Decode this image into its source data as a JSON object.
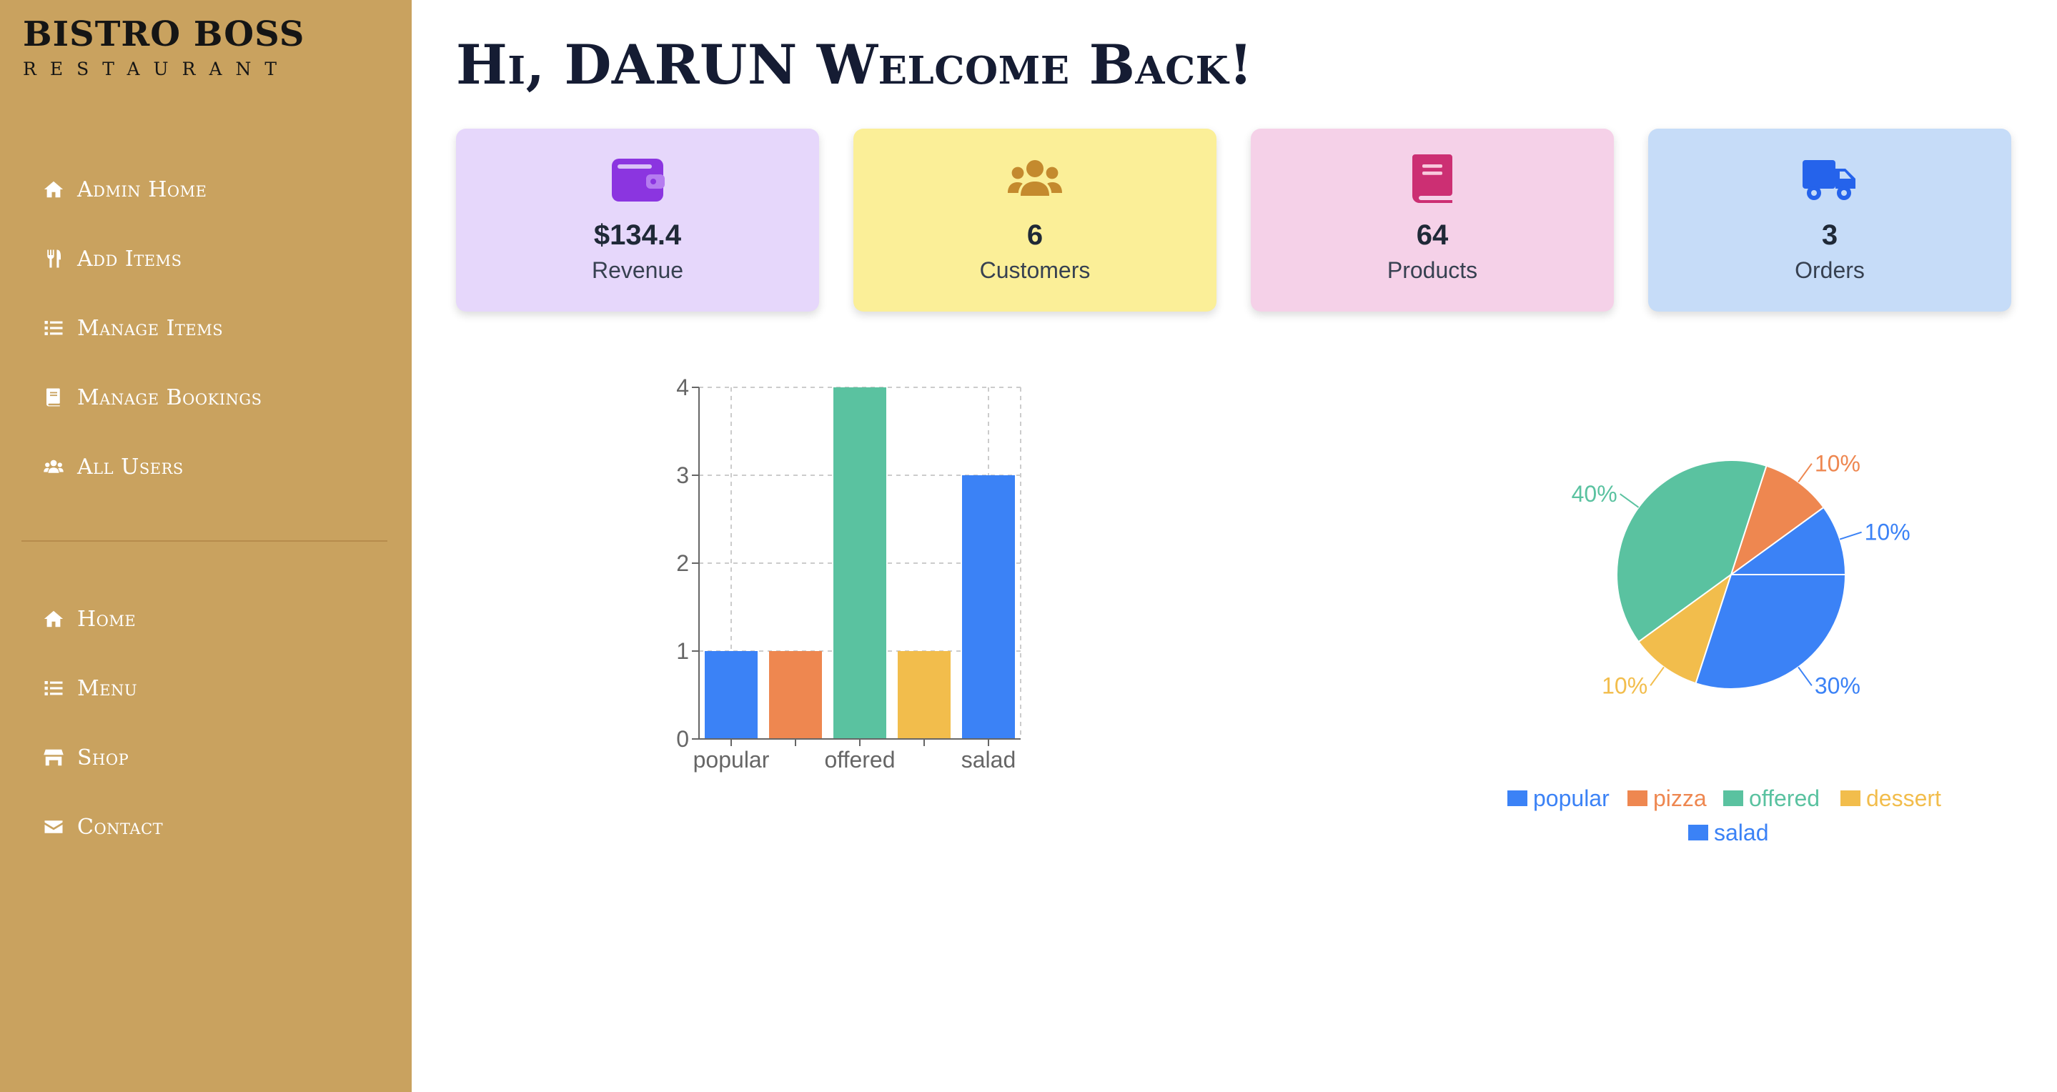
{
  "sidebar": {
    "brand_title": "BISTRO BOSS",
    "brand_subtitle": "Restaurant",
    "admin_items": [
      {
        "label": "Admin Home",
        "icon": "home-icon"
      },
      {
        "label": "Add Items",
        "icon": "utensils-icon"
      },
      {
        "label": "Manage Items",
        "icon": "list-icon"
      },
      {
        "label": "Manage Bookings",
        "icon": "book-icon"
      },
      {
        "label": "All Users",
        "icon": "users-icon"
      }
    ],
    "site_items": [
      {
        "label": "Home",
        "icon": "home-icon"
      },
      {
        "label": "Menu",
        "icon": "list-icon"
      },
      {
        "label": "Shop",
        "icon": "store-icon"
      },
      {
        "label": "Contact",
        "icon": "envelope-icon"
      }
    ],
    "colors": {
      "background": "#c9a25f",
      "text": "#ffffff"
    }
  },
  "main": {
    "greeting": "Hi, DARUN Welcome Back!",
    "stats": [
      {
        "value": "$134.4",
        "label": "Revenue",
        "icon": "wallet-icon",
        "bg": "#e6d7fb",
        "icon_color": "#8b35e0"
      },
      {
        "value": "6",
        "label": "Customers",
        "icon": "users-icon",
        "bg": "#fbef98",
        "icon_color": "#c48a2e"
      },
      {
        "value": "64",
        "label": "Products",
        "icon": "book-icon",
        "bg": "#f5d1e8",
        "icon_color": "#cc2f73"
      },
      {
        "value": "3",
        "label": "Orders",
        "icon": "truck-icon",
        "bg": "#c6dcf8",
        "icon_color": "#2563eb"
      }
    ]
  },
  "chart_data": [
    {
      "type": "bar",
      "categories": [
        "popular",
        "pizza",
        "offered",
        "dessert",
        "salad"
      ],
      "visible_tick_labels": [
        "popular",
        "offered",
        "salad"
      ],
      "values": [
        1,
        1,
        4,
        1,
        3
      ],
      "colors": [
        "#3b82f6",
        "#ee8750",
        "#5ac2a0",
        "#f2bd4c",
        "#3b82f6"
      ],
      "ylim": [
        0,
        4
      ],
      "yticks": [
        0,
        1,
        2,
        3,
        4
      ],
      "grid": true
    },
    {
      "type": "pie",
      "categories": [
        "popular",
        "pizza",
        "offered",
        "dessert",
        "salad"
      ],
      "values": [
        10,
        10,
        40,
        10,
        30
      ],
      "labels": [
        "10%",
        "10%",
        "40%",
        "10%",
        "30%"
      ],
      "colors": [
        "#3b82f6",
        "#ee8750",
        "#5ac2a0",
        "#f2bd4c",
        "#3b82f6"
      ],
      "legend": [
        "popular",
        "pizza",
        "offered",
        "dessert",
        "salad"
      ],
      "legend_position": "bottom"
    }
  ]
}
